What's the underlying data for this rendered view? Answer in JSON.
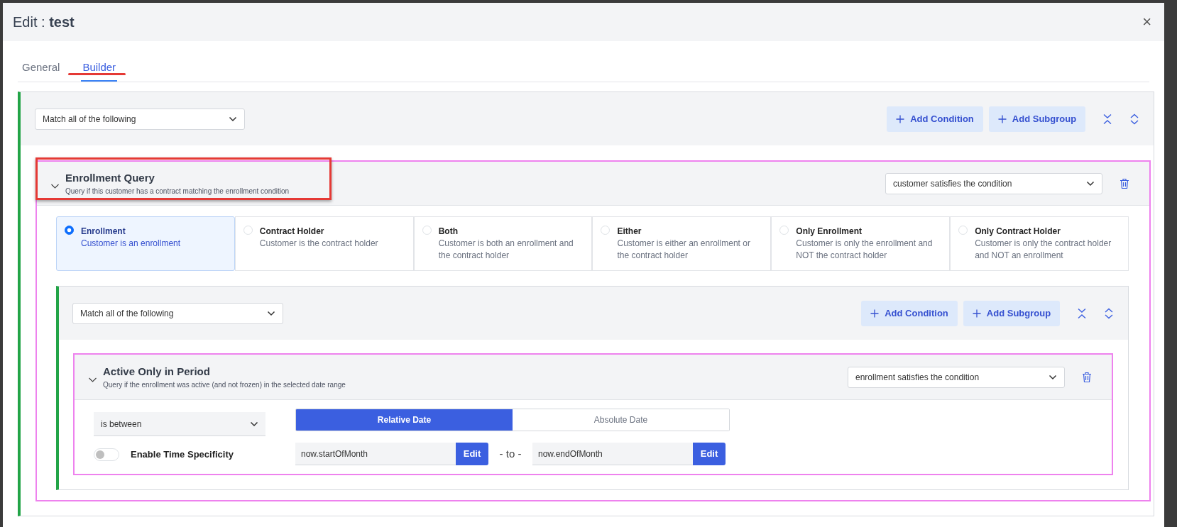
{
  "dialog": {
    "title_prefix": "Edit : ",
    "title_name": "test",
    "close": "×"
  },
  "tabs": [
    {
      "label": "General",
      "selected": false,
      "highlighted": false
    },
    {
      "label": "Builder",
      "selected": true,
      "highlighted": true
    }
  ],
  "root_group": {
    "match": "Match all of the following",
    "buttons": [
      "Add Condition",
      "Add Subgroup"
    ],
    "conditions": [
      {
        "kind": "choice",
        "title": "Enrollment Query",
        "description": "Query if this customer has a contract matching the enrollment condition",
        "expanded": true,
        "highlighted": true,
        "subject": "customer satisfies the condition",
        "options": [
          {
            "title": "Enrollment",
            "description": "Customer is an enrollment",
            "selected": true
          },
          {
            "title": "Contract Holder",
            "description": "Customer is the contract holder",
            "selected": false
          },
          {
            "title": "Both",
            "description": "Customer is both an enrollment and the contract holder",
            "selected": false
          },
          {
            "title": "Either",
            "description": "Customer is either an enrollment or the contract holder",
            "selected": false
          },
          {
            "title": "Only Enrollment",
            "description": "Customer is only the enrollment and NOT the contract holder",
            "selected": false
          },
          {
            "title": "Only Contract Holder",
            "description": "Customer is only the contract holder and NOT an enrollment",
            "selected": false
          }
        ],
        "group": {
          "match": "Match all of the following",
          "buttons": [
            "Add Condition",
            "Add Subgroup"
          ],
          "conditions": [
            {
              "kind": "date_range",
              "title": "Active Only in Period",
              "description": "Query if the enrollment was active (and not frozen) in the selected date range",
              "expanded": true,
              "highlighted": false,
              "subject": "enrollment satisfies the condition",
              "operator": "is between",
              "time_specificity": {
                "label": "Enable Time Specificity",
                "on": false
              },
              "date_modes": [
                {
                  "label": "Relative Date",
                  "selected": true
                },
                {
                  "label": "Absolute Date",
                  "selected": false
                }
              ],
              "from": {
                "value": "now.startOfMonth",
                "button": "Edit"
              },
              "separator": "- to -",
              "to": {
                "value": "now.endOfMonth",
                "button": "Edit"
              }
            }
          ]
        }
      }
    ]
  }
}
